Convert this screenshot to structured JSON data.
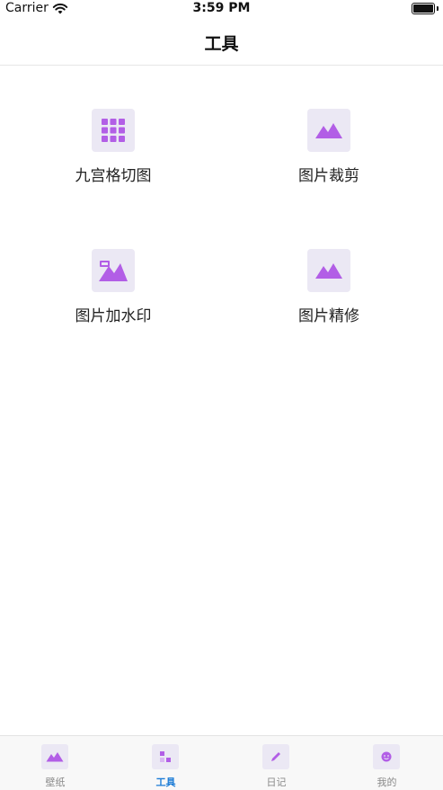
{
  "status_bar": {
    "carrier": "Carrier",
    "time": "3:59 PM"
  },
  "nav": {
    "title": "工具"
  },
  "tools": [
    {
      "label": "九宫格切图",
      "icon": "grid-icon"
    },
    {
      "label": "图片裁剪",
      "icon": "mountain-icon"
    },
    {
      "label": "图片加水印",
      "icon": "watermark-icon"
    },
    {
      "label": "图片精修",
      "icon": "mountain-icon"
    }
  ],
  "tab_bar": {
    "items": [
      {
        "label": "壁纸",
        "icon": "mountain-icon",
        "active": false
      },
      {
        "label": "工具",
        "icon": "squares-icon",
        "active": true
      },
      {
        "label": "日记",
        "icon": "pen-icon",
        "active": false
      },
      {
        "label": "我的",
        "icon": "face-icon",
        "active": false
      }
    ]
  },
  "colors": {
    "icon_purple": "#b25ee6",
    "icon_bg": "#ebe8f4",
    "tab_active": "#1c7cd6",
    "tab_inactive": "#8a8a8a"
  }
}
